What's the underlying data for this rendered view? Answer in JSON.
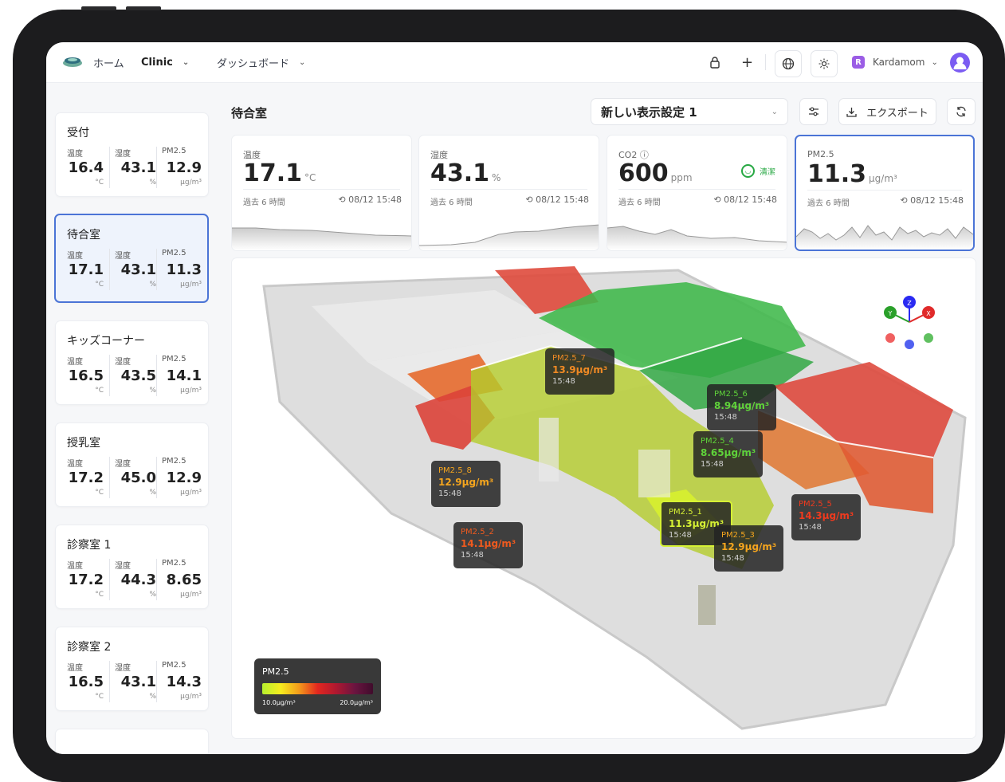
{
  "header": {
    "home": "ホーム",
    "org": "Clinic",
    "dashboard": "ダッシュボード",
    "user": "Kardamom",
    "user_initial": "R"
  },
  "sidebar": {
    "rooms": [
      {
        "name": "受付",
        "temp_label": "温度",
        "hum_label": "湿度",
        "pm_label": "PM2.5",
        "temp": "16.4",
        "hum": "43.1",
        "pm": "12.9",
        "temp_unit": "°C",
        "hum_unit": "%",
        "pm_unit": "μg/m³"
      },
      {
        "name": "待合室",
        "temp_label": "温度",
        "hum_label": "湿度",
        "pm_label": "PM2.5",
        "temp": "17.1",
        "hum": "43.1",
        "pm": "11.3",
        "temp_unit": "°C",
        "hum_unit": "%",
        "pm_unit": "μg/m³"
      },
      {
        "name": "キッズコーナー",
        "temp_label": "温度",
        "hum_label": "湿度",
        "pm_label": "PM2.5",
        "temp": "16.5",
        "hum": "43.5",
        "pm": "14.1",
        "temp_unit": "°C",
        "hum_unit": "%",
        "pm_unit": "μg/m³"
      },
      {
        "name": "授乳室",
        "temp_label": "温度",
        "hum_label": "湿度",
        "pm_label": "PM2.5",
        "temp": "17.2",
        "hum": "45.0",
        "pm": "12.9",
        "temp_unit": "°C",
        "hum_unit": "%",
        "pm_unit": "μg/m³"
      },
      {
        "name": "診察室 1",
        "temp_label": "温度",
        "hum_label": "湿度",
        "pm_label": "PM2.5",
        "temp": "17.2",
        "hum": "44.3",
        "pm": "8.65",
        "temp_unit": "°C",
        "hum_unit": "%",
        "pm_unit": "μg/m³"
      },
      {
        "name": "診察室 2",
        "temp_label": "温度",
        "hum_label": "湿度",
        "pm_label": "PM2.5",
        "temp": "16.5",
        "hum": "43.1",
        "pm": "14.3",
        "temp_unit": "°C",
        "hum_unit": "%",
        "pm_unit": "μg/m³"
      }
    ]
  },
  "main": {
    "title": "待合室",
    "view_setting": "新しい表示設定 1",
    "export": "エクスポート",
    "metrics": [
      {
        "label": "温度",
        "value": "17.1",
        "unit": "°C",
        "period": "過去 6 時間",
        "time": "08/12 15:48"
      },
      {
        "label": "湿度",
        "value": "43.1",
        "unit": "%",
        "period": "過去 6 時間",
        "time": "08/12 15:48"
      },
      {
        "label": "CO2",
        "value": "600",
        "unit": "ppm",
        "period": "過去 6 時間",
        "time": "08/12 15:48",
        "status": "清潔"
      },
      {
        "label": "PM2.5",
        "value": "11.3",
        "unit": "μg/m³",
        "period": "過去 6 時間",
        "time": "08/12 15:48"
      }
    ]
  },
  "sensors": [
    {
      "name": "PM2.5_7",
      "value": "13.9μg/m³",
      "time": "15:48",
      "color": "#f08a24"
    },
    {
      "name": "PM2.5_6",
      "value": "8.94μg/m³",
      "time": "15:48",
      "color": "#5fd33a"
    },
    {
      "name": "PM2.5_4",
      "value": "8.65μg/m³",
      "time": "15:48",
      "color": "#5fd33a"
    },
    {
      "name": "PM2.5_8",
      "value": "12.9μg/m³",
      "time": "15:48",
      "color": "#f5a51e"
    },
    {
      "name": "PM2.5_1",
      "value": "11.3μg/m³",
      "time": "15:48",
      "color": "#d6f134"
    },
    {
      "name": "PM2.5_2",
      "value": "14.1μg/m³",
      "time": "15:48",
      "color": "#f05a1e"
    },
    {
      "name": "PM2.5_3",
      "value": "12.9μg/m³",
      "time": "15:48",
      "color": "#f5a51e"
    },
    {
      "name": "PM2.5_5",
      "value": "14.3μg/m³",
      "time": "15:48",
      "color": "#f03a1e"
    }
  ],
  "legend": {
    "title": "PM2.5",
    "min": "10.0μg/m³",
    "max": "20.0μg/m³"
  },
  "axis_gizmo": {
    "labels": [
      "Y",
      "Z",
      "X"
    ]
  }
}
